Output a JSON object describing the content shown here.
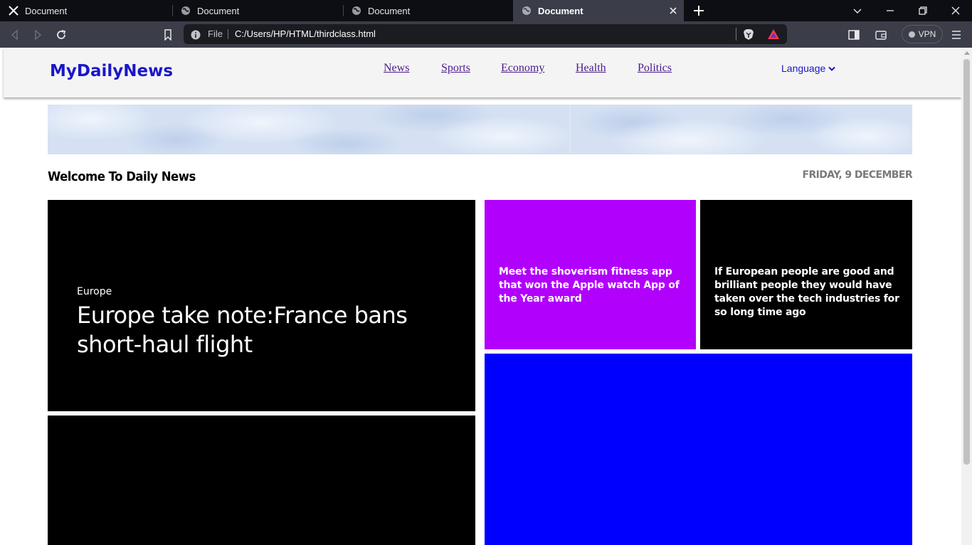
{
  "browser": {
    "tabs": [
      {
        "title": "Document",
        "icon": "x-logo-icon",
        "active": false
      },
      {
        "title": "Document",
        "icon": "globe-icon",
        "active": false
      },
      {
        "title": "Document",
        "icon": "globe-icon",
        "active": false
      },
      {
        "title": "Document",
        "icon": "globe-icon",
        "active": true
      }
    ],
    "url_scheme_label": "File",
    "url": "C:/Users/HP/HTML/thirdclass.html",
    "vpn_label": "VPN",
    "colors": {
      "tabbar": "#0d0e14",
      "toolbar": "#3b3d49",
      "urlbar": "#1b1c22"
    }
  },
  "site": {
    "logo": "MyDailyNews",
    "nav": [
      "News",
      "Sports",
      "Economy",
      "Health",
      "Politics"
    ],
    "language_label": "Language",
    "colors": {
      "logo": "#1a17c9",
      "nav_link": "#4a1a8c"
    }
  },
  "section": {
    "welcome": "Welcome To Daily News",
    "date": "FRIDAY, 9 DECEMBER"
  },
  "cards": {
    "main": {
      "category": "Europe",
      "headline": "Europe take note:France bans short-haul flight",
      "color": "#000000"
    },
    "purple": {
      "text": "Meet the shoverism fitness app that won the Apple watch App of the Year award",
      "color": "#b100fb"
    },
    "black": {
      "text": "If European people are good and brilliant people they would have taken over the tech industries for so long time ago",
      "color": "#000000"
    },
    "blue": {
      "color": "#0000ff"
    },
    "bottom_left": {
      "color": "#000000"
    }
  }
}
